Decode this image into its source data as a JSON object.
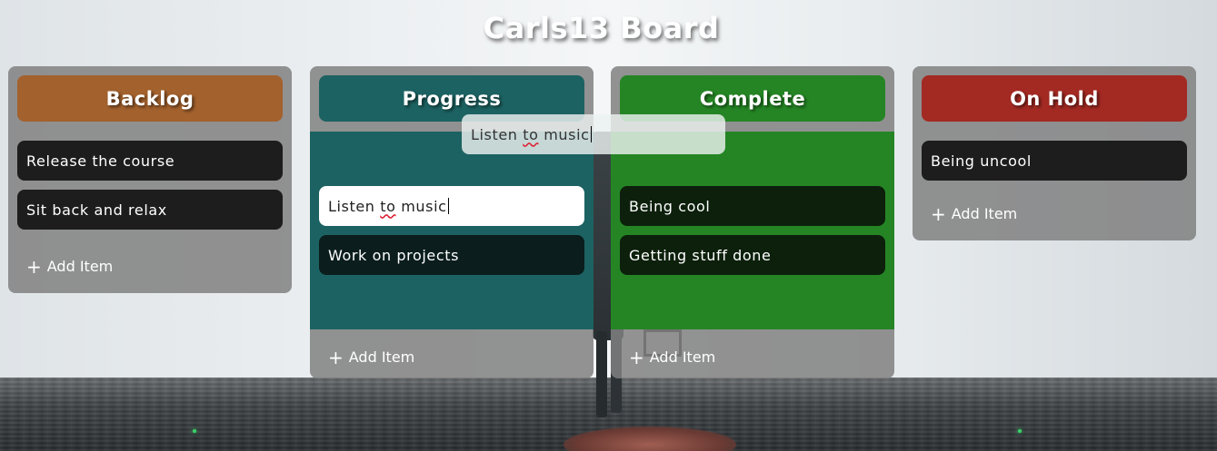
{
  "board": {
    "title": "Carls13 Board"
  },
  "columns": [
    {
      "name": "Backlog",
      "color": "#a3612d",
      "items": [
        "Release the course",
        "Sit back and relax"
      ],
      "add_label": "Add Item"
    },
    {
      "name": "Progress",
      "color": "#1d6262",
      "list_color": "#1d6262",
      "items": [
        "Listen to music",
        "Work on projects"
      ],
      "add_label": "Add Item"
    },
    {
      "name": "Complete",
      "color": "#258525",
      "list_color": "#258525",
      "items": [
        "Being cool",
        "Getting stuff done"
      ],
      "add_label": "Add Item"
    },
    {
      "name": "On Hold",
      "color": "#a32a23",
      "items": [
        "Being uncool"
      ],
      "add_label": "Add Item"
    }
  ],
  "drag": {
    "text": "Listen to music"
  },
  "icons": {
    "add": "plus-icon"
  }
}
